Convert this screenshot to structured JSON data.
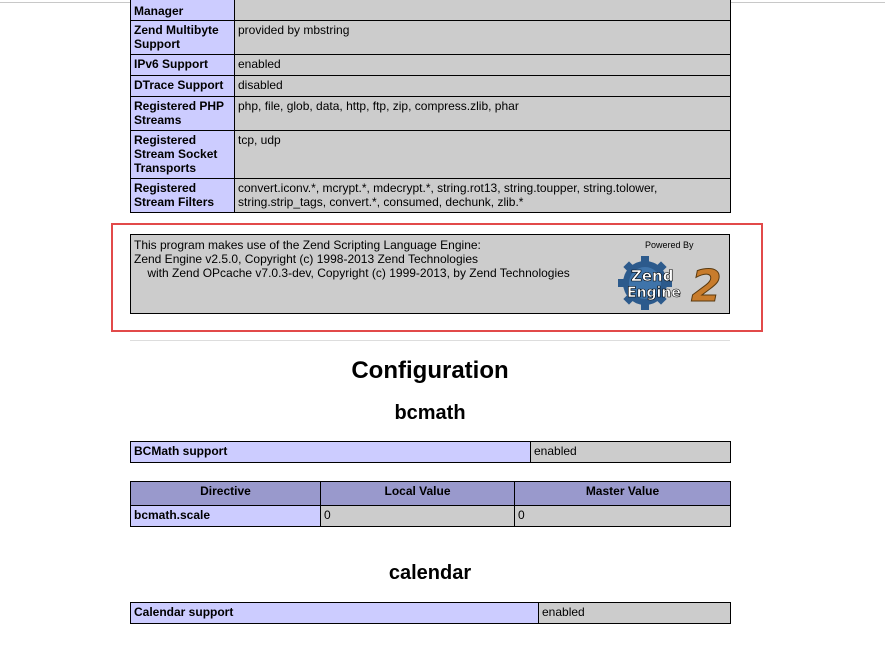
{
  "top_table": {
    "rows": [
      {
        "name": "Manager",
        "value": ""
      },
      {
        "name": "Zend Multibyte Support",
        "value": "provided by mbstring"
      },
      {
        "name": "IPv6 Support",
        "value": "enabled"
      },
      {
        "name": "DTrace Support",
        "value": "disabled"
      },
      {
        "name": "Registered PHP Streams",
        "value": "php, file, glob, data, http, ftp, zip, compress.zlib, phar"
      },
      {
        "name": "Registered Stream Socket Transports",
        "value": "tcp, udp"
      },
      {
        "name": "Registered Stream Filters",
        "value": "convert.iconv.*, mcrypt.*, mdecrypt.*, string.rot13, string.toupper, string.tolower, string.strip_tags, convert.*, consumed, dechunk, zlib.*"
      }
    ]
  },
  "zend": {
    "line1": "This program makes use of the Zend Scripting Language Engine:",
    "line2": "Zend Engine v2.5.0, Copyright (c) 1998-2013 Zend Technologies",
    "line3": "    with Zend OPcache v7.0.3-dev, Copyright (c) 1999-2013, by Zend Technologies",
    "logo": {
      "powered_by": "Powered By",
      "word1": "Zend",
      "word2": "Engine",
      "number": "2"
    },
    "highlight_color": "#e24a4a"
  },
  "configuration": {
    "title": "Configuration",
    "sections": [
      {
        "name": "bcmath",
        "support_label": "BCMath support",
        "support_value": "enabled",
        "directive_headers": [
          "Directive",
          "Local Value",
          "Master Value"
        ],
        "directives": [
          {
            "name": "bcmath.scale",
            "local": "0",
            "master": "0"
          }
        ]
      },
      {
        "name": "calendar",
        "support_label": "Calendar support",
        "support_value": "enabled"
      }
    ]
  },
  "colors": {
    "entry_bg": "#ccccff",
    "value_bg": "#cccccc",
    "header_bg": "#9999cc"
  }
}
